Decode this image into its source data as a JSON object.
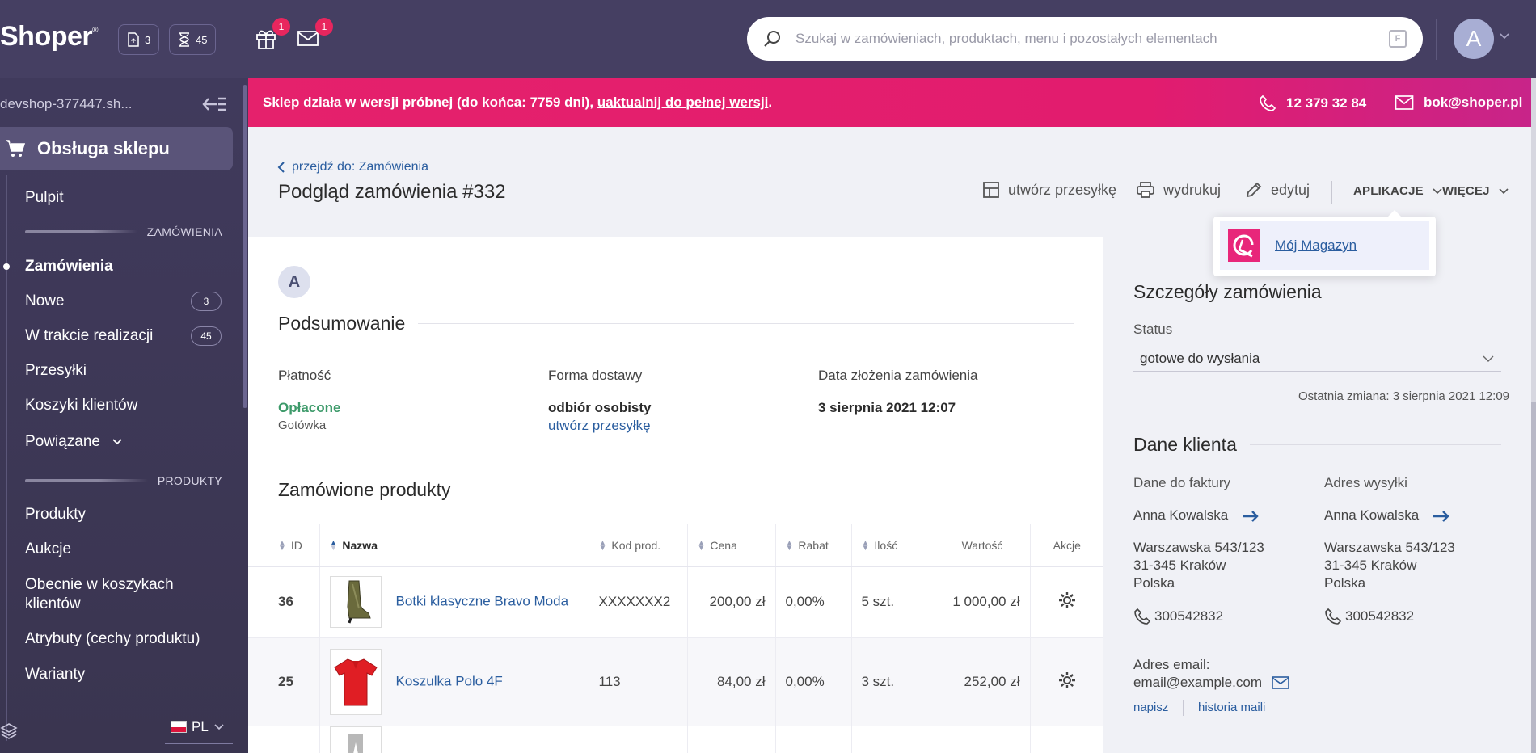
{
  "app": {
    "logo": "Shoper",
    "logo_mark": "®"
  },
  "topbar": {
    "counter_docs": "3",
    "counter_hourglass": "45",
    "gift_badge": "1",
    "mail_badge": "1",
    "search_placeholder": "Szukaj w zamówieniach, produktach, menu i pozostałych elementach",
    "filter_key": "F",
    "user_initial": "A"
  },
  "sidebar": {
    "shop_name": "devshop-377447.sh...",
    "main_item": "Obsługa sklepu",
    "items": {
      "pulpit": "Pulpit",
      "section_orders": "ZAMÓWIENIA",
      "orders": "Zamówienia",
      "new": "Nowe",
      "new_count": "3",
      "in_progress": "W trakcie realizacji",
      "in_progress_count": "45",
      "shipments": "Przesyłki",
      "carts": "Koszyki klientów",
      "related": "Powiązane",
      "section_products": "PRODUKTY",
      "products": "Produkty",
      "auctions": "Aukcje",
      "in_carts_l1": "Obecnie w koszykach",
      "in_carts_l2": "klientów",
      "attributes": "Atrybuty (cechy produktu)",
      "variants": "Warianty"
    },
    "language": "PL"
  },
  "banner": {
    "text": "Sklep działa w wersji próbnej (do końca: 7759 dni), ",
    "link": "uaktualnij do pełnej wersji",
    "text_end": ".",
    "phone": "12 379 32 84",
    "email": "bok@shoper.pl",
    "color": "#e5216c"
  },
  "header": {
    "breadcrumb": "przejdź do: Zamówienia",
    "title": "Podgląd zamówienia #332",
    "actions": {
      "create_shipment": "utwórz przesyłkę",
      "print": "wydrukuj",
      "edit": "edytuj",
      "apps": "APLIKACJE",
      "more": "WIĘCEJ"
    }
  },
  "apps_dropdown": {
    "item": "Mój Magazyn"
  },
  "summary": {
    "customer_initial": "A",
    "title": "Podsumowanie",
    "payment_label": "Płatność",
    "payment_status": "Opłacone",
    "payment_method": "Gotówka",
    "delivery_label": "Forma dostawy",
    "delivery_value": "odbiór osobisty",
    "delivery_link": "utwórz przesyłkę",
    "date_label": "Data złożenia zamówienia",
    "date_value": "3 sierpnia 2021 12:07"
  },
  "products": {
    "title": "Zamówione produkty",
    "columns": {
      "id": "ID",
      "name": "Nazwa",
      "code": "Kod prod.",
      "price": "Cena",
      "discount": "Rabat",
      "qty": "Ilość",
      "value": "Wartość",
      "actions": "Akcje"
    },
    "rows": [
      {
        "id": "36",
        "name": "Botki klasyczne Bravo Moda",
        "code": "XXXXXXX2",
        "price": "200,00 zł",
        "discount": "0,00%",
        "qty": "5 szt.",
        "value": "1 000,00 zł"
      },
      {
        "id": "25",
        "name": "Koszulka Polo 4F",
        "code": "113",
        "price": "84,00 zł",
        "discount": "0,00%",
        "qty": "3 szt.",
        "value": "252,00 zł"
      }
    ]
  },
  "order_details": {
    "title": "Szczegóły zamówienia",
    "status_label": "Status",
    "status_value": "gotowe do wysłania",
    "last_change": "Ostatnia zmiana: 3 sierpnia 2021 12:09"
  },
  "customer": {
    "title": "Dane klienta",
    "invoice_label": "Dane do faktury",
    "shipping_label": "Adres wysyłki",
    "invoice": {
      "name": "Anna Kowalska",
      "street": "Warszawska 543/123",
      "city": "31-345 Kraków",
      "country": "Polska",
      "phone": "300542832"
    },
    "shipping": {
      "name": "Anna Kowalska",
      "street": "Warszawska 543/123",
      "city": "31-345 Kraków",
      "country": "Polska",
      "phone": "300542832"
    },
    "email_label": "Adres email:",
    "email": "email@example.com",
    "write_link": "napisz",
    "history_link": "historia maili"
  }
}
